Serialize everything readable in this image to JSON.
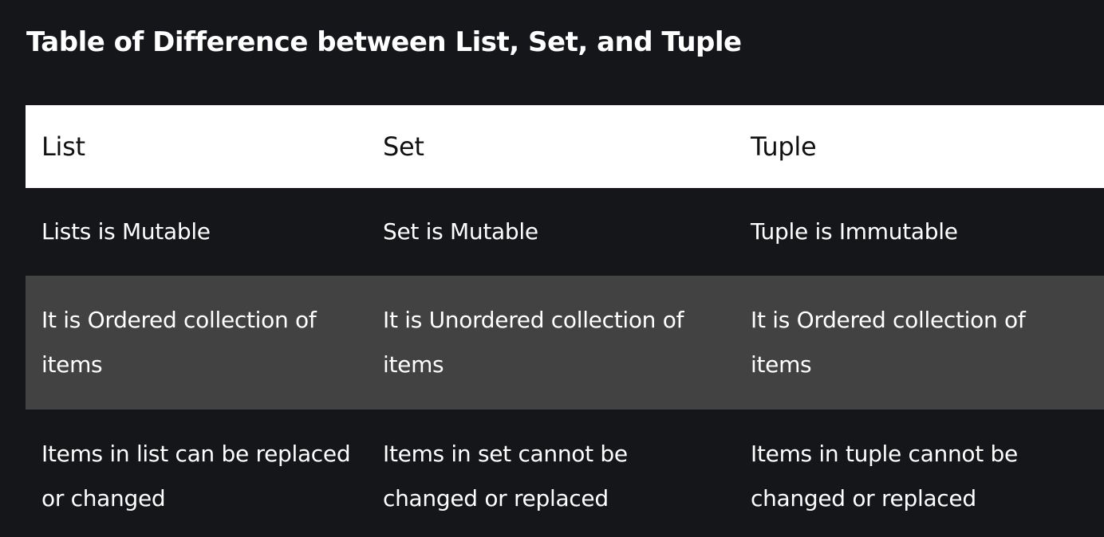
{
  "title": "Table of Difference between List, Set, and Tuple",
  "table": {
    "headers": [
      "List",
      "Set",
      "Tuple"
    ],
    "rows": [
      [
        "Lists is Mutable",
        "Set is Mutable",
        "Tuple is Immutable"
      ],
      [
        "It is Ordered collection of items",
        "It is Unordered collection of items",
        "It is Ordered collection of items"
      ],
      [
        "Items in list can be replaced or changed",
        "Items in set cannot be changed or replaced",
        "Items in tuple cannot be changed or replaced"
      ]
    ]
  },
  "colors": {
    "background": "#151619",
    "header_background": "#ffffff",
    "striped_row": "#424242",
    "text": "#ffffff",
    "header_text": "#111111"
  }
}
